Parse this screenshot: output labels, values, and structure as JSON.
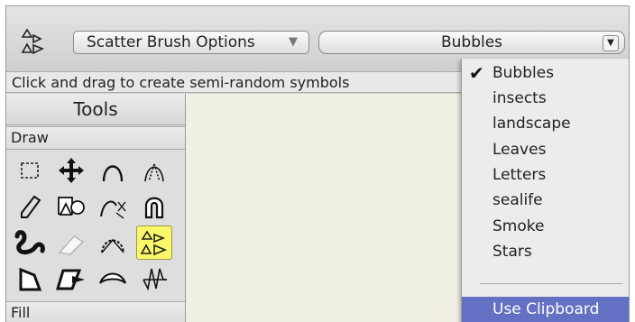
{
  "toolbar": {
    "brush_options_label": "Scatter Brush Options",
    "brush_options_arrow": "▼",
    "symbol_set_value": "Bubbles",
    "symbol_set_arrow": "▼"
  },
  "hint": "Click and drag to create semi-random symbols",
  "tools": {
    "title": "Tools",
    "sections": {
      "draw": "Draw",
      "fill": "Fill"
    },
    "items": [
      {
        "icon": "marquee-select-icon"
      },
      {
        "icon": "move-icon"
      },
      {
        "icon": "arc-icon"
      },
      {
        "icon": "parabola-icon"
      },
      {
        "icon": "pencil-icon"
      },
      {
        "icon": "shapes-icon"
      },
      {
        "icon": "bezier-path-icon"
      },
      {
        "icon": "magnet-icon"
      },
      {
        "icon": "smooth-brush-icon"
      },
      {
        "icon": "eraser-icon"
      },
      {
        "icon": "polygon-arc-icon"
      },
      {
        "icon": "scatter-brush-icon",
        "selected": true
      },
      {
        "icon": "closed-shape-icon"
      },
      {
        "icon": "parallelogram-arrow-icon"
      },
      {
        "icon": "curved-connector-icon"
      },
      {
        "icon": "zigzag-icon"
      }
    ]
  },
  "menu": {
    "items": [
      "Bubbles",
      "insects",
      "landscape",
      "Leaves",
      "Letters",
      "sealife",
      "Smoke",
      "Stars"
    ],
    "checked": "Bubbles",
    "check_glyph": "✔",
    "footer_item": "Use Clipboard",
    "highlight_color": "#6470c4"
  },
  "colors": {
    "selected_tool": "#fbf76a",
    "canvas": "#f1f0e4"
  }
}
